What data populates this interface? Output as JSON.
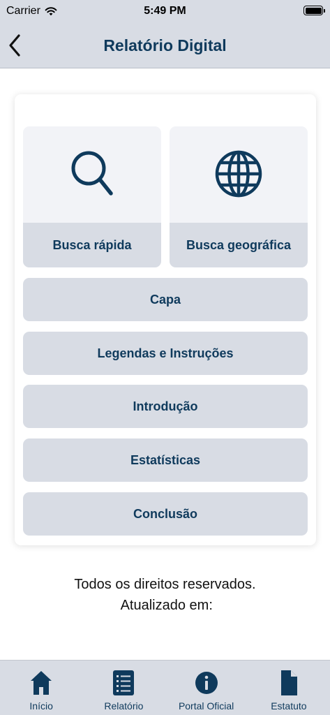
{
  "status_bar": {
    "carrier": "Carrier",
    "time": "5:49 PM",
    "wifi_icon": "wifi-icon",
    "battery_level": 1.0
  },
  "nav": {
    "title": "Relatório Digital",
    "back_icon": "chevron-left-icon"
  },
  "tiles": [
    {
      "label": "Busca rápida",
      "icon": "search-icon"
    },
    {
      "label": "Busca geográfica",
      "icon": "globe-icon"
    }
  ],
  "menu": [
    {
      "label": "Capa"
    },
    {
      "label": "Legendas e Instruções"
    },
    {
      "label": "Introdução"
    },
    {
      "label": "Estatísticas"
    },
    {
      "label": "Conclusão"
    }
  ],
  "footer": {
    "rights": "Todos os direitos reservados.",
    "updated": " Atualizado em:"
  },
  "tab_bar": [
    {
      "label": "Início",
      "icon": "home-icon"
    },
    {
      "label": "Relatório",
      "icon": "list-icon"
    },
    {
      "label": "Portal Oficial",
      "icon": "info-icon"
    },
    {
      "label": "Estatuto",
      "icon": "document-icon"
    }
  ],
  "colors": {
    "accent": "#0f3a5c",
    "bar_bg": "#d8dce4",
    "tile_bg": "#f2f3f7"
  }
}
